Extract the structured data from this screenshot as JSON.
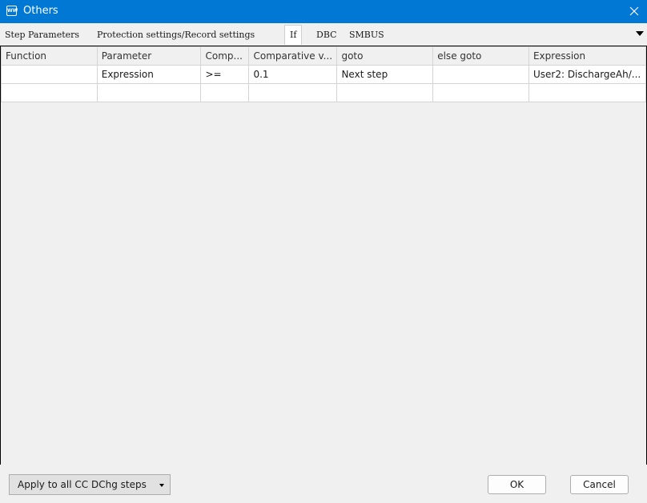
{
  "window": {
    "icon_text": "WW",
    "title": "Others"
  },
  "tabs": {
    "step_parameters": "Step Parameters",
    "protection": "Protection settings/Record settings",
    "if": "If",
    "dbc": "DBC",
    "smbus": "SMBUS",
    "active": "If"
  },
  "grid": {
    "columns": [
      "Function",
      "Parameter",
      "Comp...",
      "Comparative v...",
      "goto",
      "else goto",
      "Expression"
    ],
    "rows": [
      [
        "",
        "Expression",
        ">=",
        "0.1",
        "Next step",
        "",
        "User2: DischargeAh/..."
      ],
      [
        "",
        "",
        "",
        "",
        "",
        "",
        ""
      ]
    ]
  },
  "footer": {
    "apply_label": "Apply to all CC DChg steps",
    "ok_label": "OK",
    "cancel_label": "Cancel"
  },
  "colors": {
    "titlebar": "#0078d4",
    "background": "#f0f0f0",
    "grid_border": "#d4d4d4"
  }
}
